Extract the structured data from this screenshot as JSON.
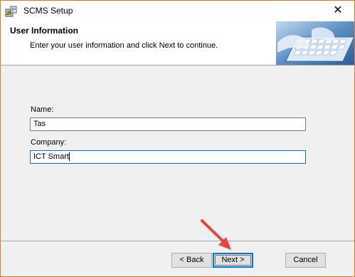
{
  "window": {
    "title": "SCMS Setup",
    "icon": "setup-package-icon",
    "close_glyph": "✕"
  },
  "header": {
    "title": "User Information",
    "subtitle": "Enter your user information and click Next to continue.",
    "banner": "keyboard-typing-image"
  },
  "form": {
    "name_label": "Name:",
    "name_value": "Tas",
    "company_label": "Company:",
    "company_value": "ICT Smart"
  },
  "buttons": {
    "back": "< Back",
    "next": "Next >",
    "cancel": "Cancel"
  },
  "annotation": {
    "arrow_color": "#e8453c",
    "points_to": "next-button"
  }
}
